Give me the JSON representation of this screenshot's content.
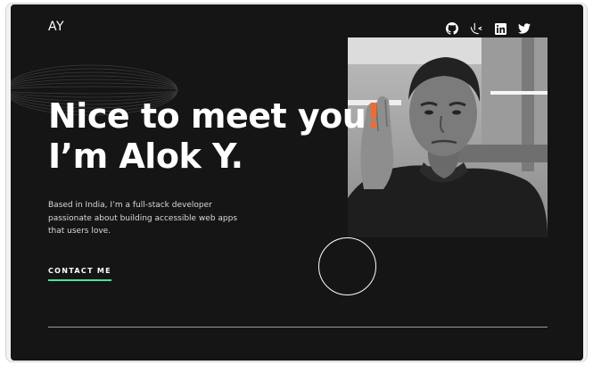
{
  "header": {
    "logo": "AY",
    "social_links": [
      {
        "icon": "github-icon"
      },
      {
        "icon": "frontend-mentor-icon"
      },
      {
        "icon": "linkedin-icon"
      },
      {
        "icon": "twitter-icon"
      }
    ]
  },
  "hero": {
    "heading_line1": "Nice to meet you",
    "heading_exclaim": "!",
    "heading_line2": "I’m Alok Y.",
    "intro": "Based in India, I’m a full-stack developer passionate about building accessible web apps that users love.",
    "cta_label": "CONTACT ME"
  },
  "colors": {
    "background": "#151515",
    "accent": "#ef6b30",
    "cta_underline": "#4ee1a0",
    "text": "#ffffff"
  }
}
